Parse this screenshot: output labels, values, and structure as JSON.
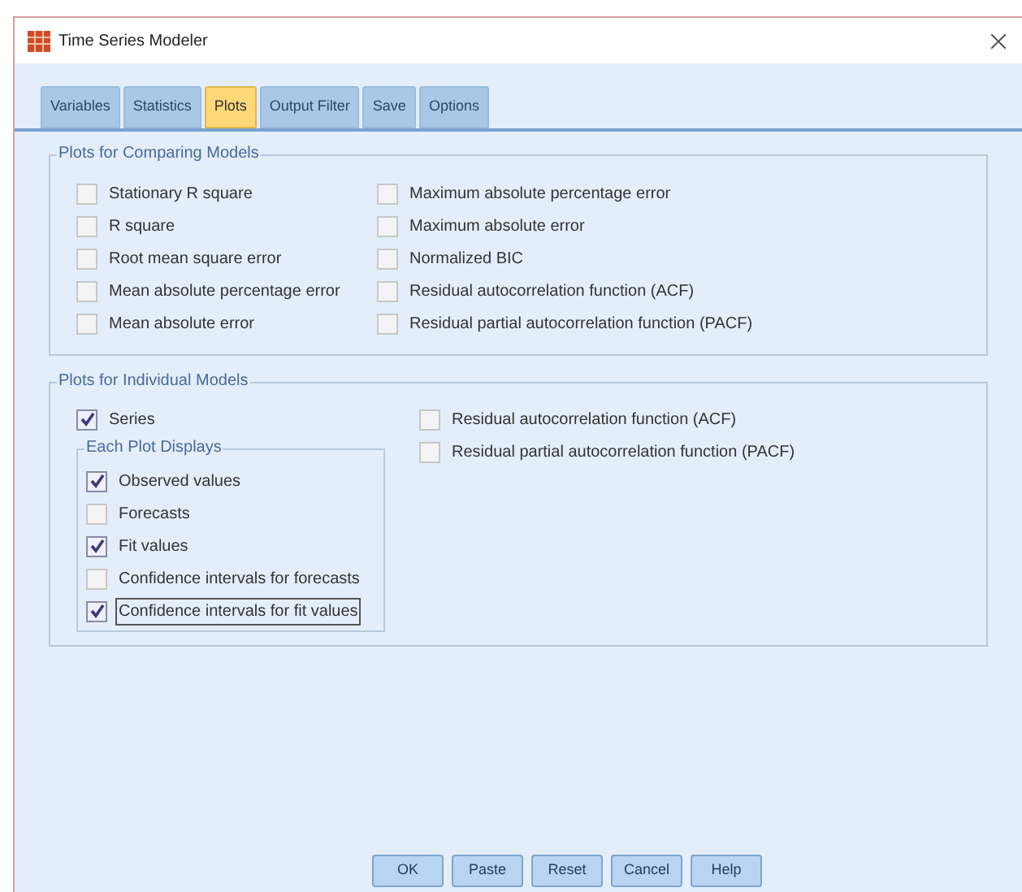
{
  "window": {
    "title": "Time Series Modeler"
  },
  "tabs": [
    {
      "label": "Variables",
      "selected": false
    },
    {
      "label": "Statistics",
      "selected": false
    },
    {
      "label": "Plots",
      "selected": true
    },
    {
      "label": "Output Filter",
      "selected": false
    },
    {
      "label": "Save",
      "selected": false
    },
    {
      "label": "Options",
      "selected": false
    }
  ],
  "comparing_models": {
    "title": "Plots for Comparing Models",
    "left": [
      {
        "label": "Stationary R square",
        "checked": false
      },
      {
        "label": "R square",
        "checked": false
      },
      {
        "label": "Root mean square error",
        "checked": false
      },
      {
        "label": "Mean absolute percentage error",
        "checked": false
      },
      {
        "label": "Mean absolute error",
        "checked": false
      }
    ],
    "right": [
      {
        "label": "Maximum absolute percentage error",
        "checked": false
      },
      {
        "label": "Maximum absolute error",
        "checked": false
      },
      {
        "label": "Normalized BIC",
        "checked": false
      },
      {
        "label": "Residual autocorrelation function (ACF)",
        "checked": false
      },
      {
        "label": "Residual partial autocorrelation function (PACF)",
        "checked": false
      }
    ]
  },
  "individual_models": {
    "title": "Plots for Individual Models",
    "series": {
      "label": "Series",
      "checked": true
    },
    "each_plot": {
      "title": "Each Plot Displays",
      "items": [
        {
          "label": "Observed values",
          "checked": true,
          "focused": false
        },
        {
          "label": "Forecasts",
          "checked": false,
          "focused": false
        },
        {
          "label": "Fit values",
          "checked": true,
          "focused": false
        },
        {
          "label": "Confidence intervals for forecasts",
          "checked": false,
          "focused": false
        },
        {
          "label": "Confidence intervals for fit values",
          "checked": true,
          "focused": true
        }
      ]
    },
    "right": [
      {
        "label": "Residual autocorrelation function (ACF)",
        "checked": false
      },
      {
        "label": "Residual partial autocorrelation function (PACF)",
        "checked": false
      }
    ]
  },
  "buttons": [
    "OK",
    "Paste",
    "Reset",
    "Cancel",
    "Help"
  ]
}
